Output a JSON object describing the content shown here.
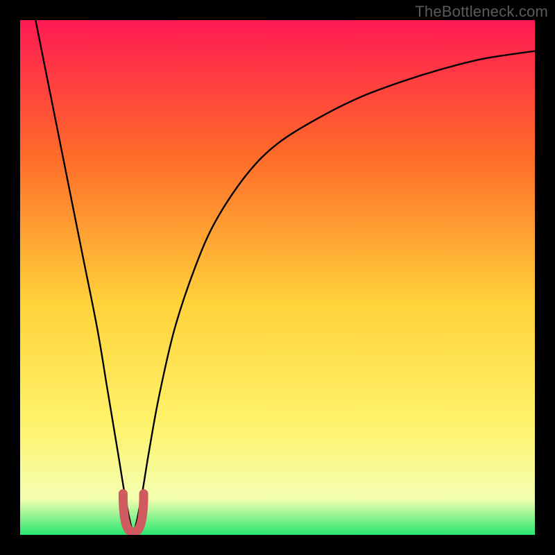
{
  "watermark": "TheBottleneck.com",
  "colors": {
    "frame": "#000000",
    "grad_top": "#ff1a53",
    "grad_mid1": "#ff6a2a",
    "grad_mid2": "#ffd23a",
    "grad_mid3": "#fff26a",
    "grad_mid4": "#f4ffb0",
    "grad_bottom": "#28e66f",
    "curve": "#000000",
    "marker_fill": "#cf5a5f",
    "marker_stroke": "#cf5a5f"
  },
  "chart_data": {
    "type": "line",
    "title": "",
    "xlabel": "",
    "ylabel": "",
    "xlim": [
      0,
      100
    ],
    "ylim": [
      0,
      100
    ],
    "series": [
      {
        "name": "bottleneck-curve",
        "x": [
          3,
          6,
          9,
          12,
          15,
          17,
          19,
          20.5,
          22,
          23.5,
          25,
          27,
          30,
          34,
          38,
          44,
          50,
          58,
          66,
          74,
          82,
          90,
          100
        ],
        "y": [
          100,
          85,
          70,
          55,
          40,
          28,
          16,
          7,
          1,
          7,
          16,
          27,
          40,
          52,
          61,
          70,
          76,
          81,
          85,
          88,
          90.5,
          92.5,
          94
        ]
      }
    ],
    "annotations": [
      {
        "name": "valley-marker",
        "x_range": [
          20,
          24
        ],
        "y_range": [
          0,
          8
        ]
      }
    ]
  }
}
